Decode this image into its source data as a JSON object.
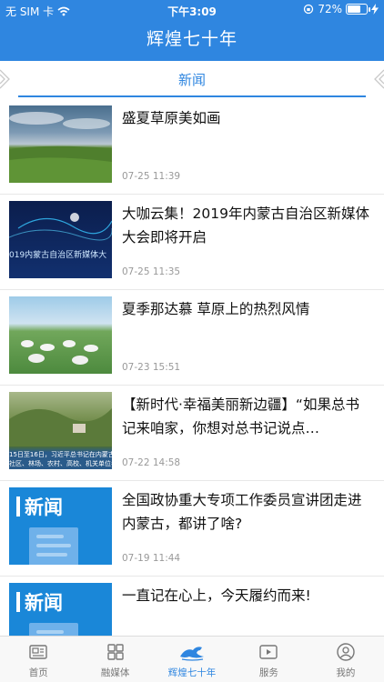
{
  "status": {
    "carrier": "无 SIM 卡",
    "time": "下午3:09",
    "battery": "72%",
    "battery_level": 0.72
  },
  "header": {
    "title": "辉煌七十年"
  },
  "tabs": {
    "active_label": "新闻"
  },
  "news": [
    {
      "title": "盛夏草原美如画",
      "time": "07-25 11:39",
      "thumb": "grassland-photo"
    },
    {
      "title": "大咖云集！2019年内蒙古自治区新媒体大会即将开启",
      "time": "07-25 11:35",
      "thumb": "conference-banner",
      "thumb_text": "019内蒙古自治区新媒体大"
    },
    {
      "title": "夏季那达慕 草原上的热烈风情",
      "time": "07-23 15:51",
      "thumb": "nadam-yurts-photo"
    },
    {
      "title": "【新时代·幸福美丽新边疆】“如果总书记来咱家，你想对总书记说点…",
      "time": "07-22 14:58",
      "thumb": "village-photo",
      "thumb_caption_1": "15日至16日，习近平总书记在内蒙古自治",
      "thumb_caption_2": "社区、林场、农村、高校、机关单位考察"
    },
    {
      "title": "全国政协重大专项工作委员宣讲团走进内蒙古，都讲了啥?",
      "time": "07-19 11:44",
      "thumb": "news-placeholder",
      "thumb_label": "新闻"
    },
    {
      "title": "一直记在心上，今天履约而来!",
      "time": "",
      "thumb": "news-placeholder",
      "thumb_label": "新闻"
    }
  ],
  "bottom_nav": [
    {
      "label": "首页",
      "icon": "newspaper-icon"
    },
    {
      "label": "融媒体",
      "icon": "grid-icon"
    },
    {
      "label": "辉煌七十年",
      "icon": "horse-icon"
    },
    {
      "label": "服务",
      "icon": "play-icon"
    },
    {
      "label": "我的",
      "icon": "user-icon"
    }
  ],
  "colors": {
    "accent": "#2f86e0",
    "muted": "#999999"
  }
}
